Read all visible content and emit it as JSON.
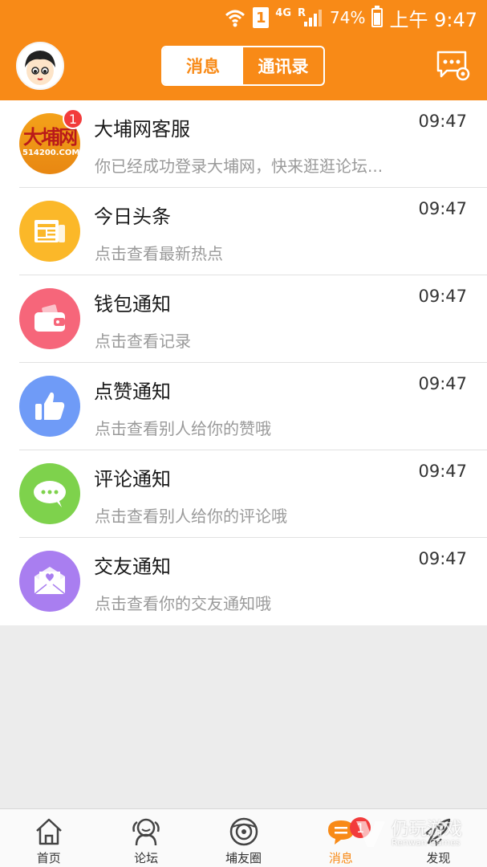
{
  "status_bar": {
    "battery": "74%",
    "battery_level": 0.74,
    "time": "上午 9:47",
    "sim": "1",
    "network": "4G",
    "roaming": "R"
  },
  "header": {
    "tabs": [
      {
        "label": "消息",
        "active": true
      },
      {
        "label": "通讯录",
        "active": false
      }
    ]
  },
  "messages": [
    {
      "title": "大埔网客服",
      "subtitle": "你已经成功登录大埔网，快来逛逛论坛...",
      "time": "09:47",
      "badge": "1",
      "icon": "dapu-logo-icon",
      "logo_big": "大埔网",
      "logo_small": "514200.COM"
    },
    {
      "title": "今日头条",
      "subtitle": "点击查看最新热点",
      "time": "09:47",
      "icon": "newspaper-icon",
      "color": "#fbb829"
    },
    {
      "title": "钱包通知",
      "subtitle": "点击查看记录",
      "time": "09:47",
      "icon": "wallet-icon",
      "color": "#f6667a"
    },
    {
      "title": "点赞通知",
      "subtitle": "点击查看别人给你的赞哦",
      "time": "09:47",
      "icon": "thumbs-up-icon",
      "color": "#6f9bf7"
    },
    {
      "title": "评论通知",
      "subtitle": "点击查看别人给你的评论哦",
      "time": "09:47",
      "icon": "comment-icon",
      "color": "#7ed24c"
    },
    {
      "title": "交友通知",
      "subtitle": "点击查看你的交友通知哦",
      "time": "09:47",
      "icon": "love-letter-icon",
      "color": "#a97ef0"
    }
  ],
  "tabbar": {
    "items": [
      {
        "label": "首页",
        "icon": "home-icon"
      },
      {
        "label": "论坛",
        "icon": "forum-icon"
      },
      {
        "label": "埔友圈",
        "icon": "moments-icon"
      },
      {
        "label": "消息",
        "icon": "message-icon",
        "active": true,
        "badge": "1"
      },
      {
        "label": "发现",
        "icon": "discover-icon"
      }
    ]
  },
  "watermark": {
    "title": "仍玩游戏",
    "subtitle": "Renwan Games"
  },
  "colors": {
    "brand": "#f88a17",
    "badge": "#f23b3b"
  }
}
